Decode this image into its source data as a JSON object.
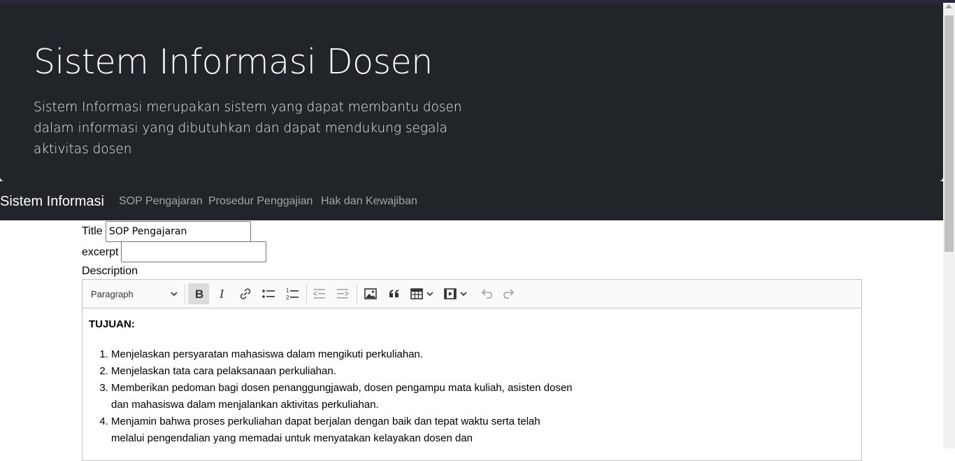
{
  "header": {
    "title": "Sistem Informasi Dosen",
    "lead": "Sistem Informasi merupakan sistem yang dapat membantu dosen dalam informasi yang dibutuhkan dan dapat mendukung segala aktivitas dosen"
  },
  "navbar": {
    "brand": "Sistem Informasi",
    "links": [
      "SOP Pengajaran",
      "Prosedur Penggajian",
      "Hak dan Kewajiban"
    ]
  },
  "form": {
    "title_label": "Title",
    "title_value": "SOP Pengajaran",
    "excerpt_label": "excerpt",
    "excerpt_value": "",
    "description_label": "Description"
  },
  "editor": {
    "heading_select": "Paragraph",
    "toolbar_icons": [
      "bold-icon",
      "italic-icon",
      "link-icon",
      "bulleted-list-icon",
      "numbered-list-icon",
      "outdent-icon",
      "indent-icon",
      "image-icon",
      "blockquote-icon",
      "table-icon",
      "media-icon",
      "undo-icon",
      "redo-icon"
    ],
    "content_heading": "TUJUAN:",
    "items": [
      "Menjelaskan persyaratan mahasiswa dalam mengikuti perkuliahan.",
      "Menjelaskan tata cara pelaksanaan perkuliahan.",
      "Memberikan pedoman bagi dosen penanggungjawab, dosen pengampu mata kuliah, asisten dosen dan mahasiswa dalam menjalankan aktivitas perkuliahan.",
      "Menjamin bahwa proses perkuliahan dapat berjalan dengan baik dan tepat waktu serta telah melalui pengendalian yang memadai untuk menyatakan kelayakan dosen dan"
    ]
  }
}
